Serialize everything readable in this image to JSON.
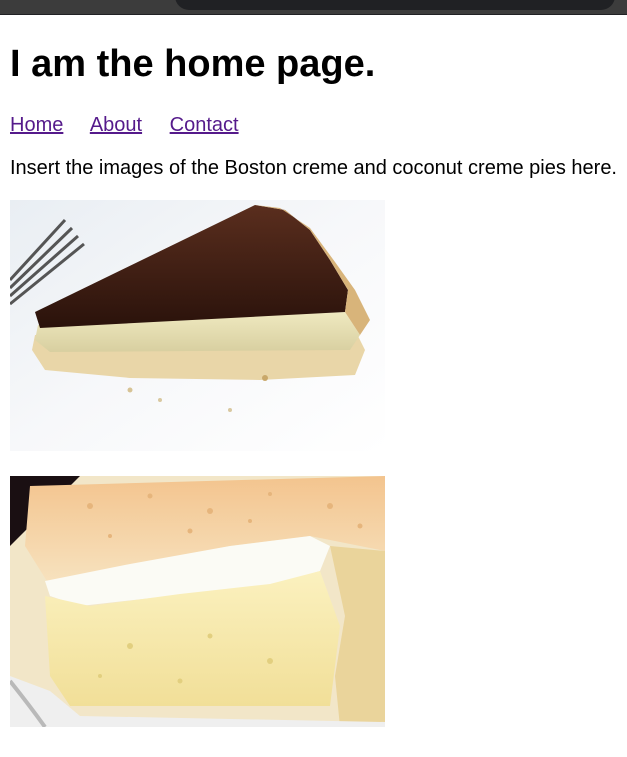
{
  "page": {
    "heading": "I am the home page.",
    "nav": [
      {
        "label": "Home"
      },
      {
        "label": "About"
      },
      {
        "label": "Contact"
      }
    ],
    "intro_text": "Insert the images of the Boston creme and coconut creme pies here."
  },
  "images": [
    {
      "name": "boston-creme-pie-photo"
    },
    {
      "name": "coconut-creme-pie-photo"
    }
  ]
}
